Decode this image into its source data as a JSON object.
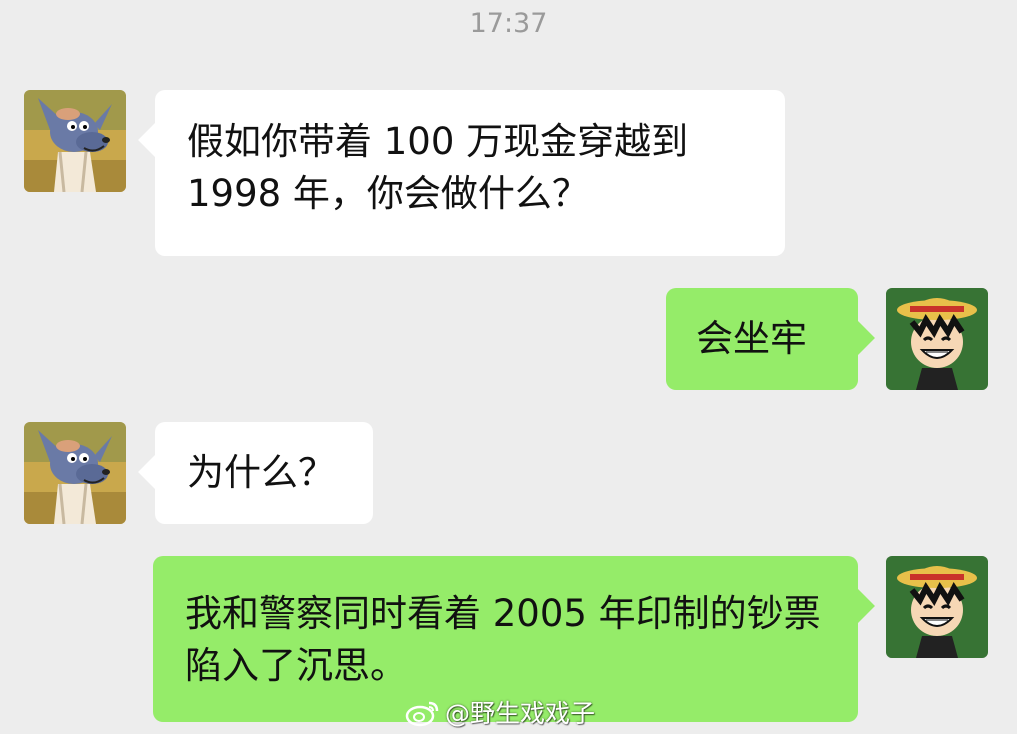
{
  "status_bar": {
    "time": "17:37"
  },
  "messages": [
    {
      "sender": "left",
      "avatar_icon": "cartoon-wolf-avatar",
      "text": "假如你带着 100 万现金穿越到 1998 年，你会做什么？"
    },
    {
      "sender": "right",
      "avatar_icon": "cartoon-straw-hat-boy-avatar",
      "text": "会坐牢"
    },
    {
      "sender": "left",
      "avatar_icon": "cartoon-wolf-avatar",
      "text": "为什么？"
    },
    {
      "sender": "right",
      "avatar_icon": "cartoon-straw-hat-boy-avatar",
      "text": "我和警察同时看着 2005 年印制的钞票陷入了沉思。"
    }
  ],
  "watermark": {
    "icon": "weibo-icon",
    "text": "@野生戏戏子"
  },
  "colors": {
    "background": "#ededed",
    "incoming_bubble": "#ffffff",
    "outgoing_bubble": "#95ec69",
    "timestamp": "#9a9a9a"
  }
}
